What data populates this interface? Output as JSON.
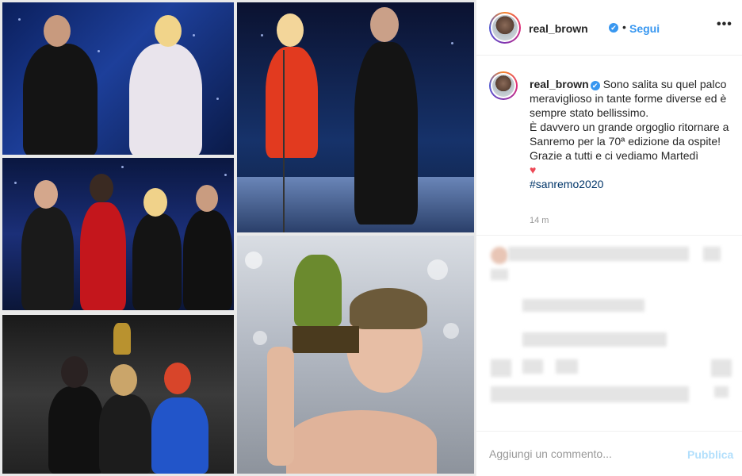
{
  "post": {
    "username": "real_brown",
    "verified_mark": "✔",
    "follow_dot": "•",
    "follow_label": "Segui",
    "more_label": "•••"
  },
  "caption": {
    "username": "real_brown",
    "lines": [
      "Sono salita su quel palco meraviglioso in tante forme diverse ed è sempre stato bellissimo.",
      "È davvero un grande orgoglio ritornare a Sanremo per la 70ª edizione da ospite!",
      "Grazie a tutti e ci vediamo Martedì"
    ],
    "heart": "♥",
    "hashtag": "#sanremo2020",
    "time": "14 m"
  },
  "comment": {
    "placeholder": "Aggiungi un commento...",
    "publish_label": "Pubblica"
  },
  "colors": {
    "link_blue": "#3897f0",
    "heart_red": "#ed4956",
    "publish_disabled": "#b2dffc"
  },
  "icons": [
    "verified-badge-icon",
    "more-options-icon",
    "heart-icon"
  ]
}
